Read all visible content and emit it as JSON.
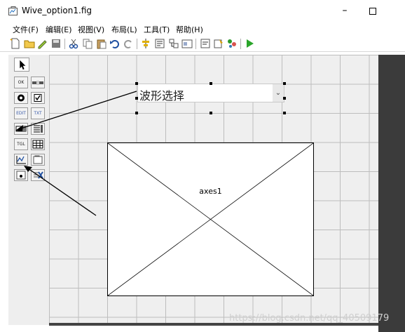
{
  "window": {
    "title": "Wive_option1.fig",
    "minimize": "–"
  },
  "menu": {
    "items": [
      "文件(F)",
      "编辑(E)",
      "视图(V)",
      "布局(L)",
      "工具(T)",
      "帮助(H)"
    ]
  },
  "palette": {
    "buttons": [
      "",
      "OK",
      "EDIT",
      "●",
      "☑",
      "EDIT",
      "TXT",
      "▭",
      "≡",
      "TGL",
      "▦",
      "~",
      "▦",
      "▦",
      "✕"
    ]
  },
  "canvas": {
    "popup_text": "波形选择",
    "popup_arrow": "⌄",
    "axes_label": "axes1"
  },
  "watermark": "https://blog.csdn.net/qq_40509179",
  "colors": {
    "run_green": "#2aa52a",
    "canvas_bg": "#efefef",
    "dark_panel": "#3b3b3b"
  }
}
